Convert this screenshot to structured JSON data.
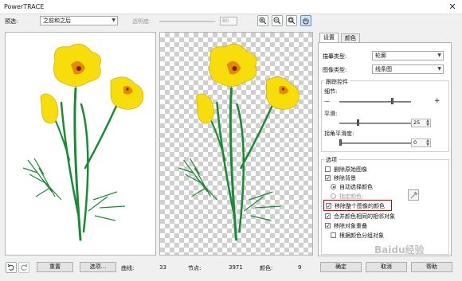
{
  "window": {
    "title": "PowerTRACE",
    "close_label": "✕"
  },
  "toolbar": {
    "preview_label": "预选:",
    "preview_value": "之前和之后",
    "transparency_label": "透明度:",
    "transparency_value": "80",
    "zoom_in_icon": "zoom-in-icon",
    "zoom_out_icon": "zoom-out-icon",
    "zoom_fit_icon": "zoom-fit-icon",
    "pan_icon": "hand-pan-icon"
  },
  "tabs": [
    {
      "label": "设置"
    },
    {
      "label": "颜色"
    }
  ],
  "settings": {
    "trace_type_label": "描摹类型:",
    "trace_type_value": "轮廓",
    "image_type_label": "图像类型:",
    "image_type_value": "线条图"
  },
  "trace_controls": {
    "title": "跟踪控件",
    "detail_label": "细节:",
    "minus": "—",
    "plus": "+",
    "detail_level": 0.75,
    "smoothing_label": "平滑:",
    "smoothing_value": "25",
    "smoothing_level": 0.25,
    "corner_label": "拐角平滑度:",
    "corner_value": "0",
    "corner_level": 0
  },
  "options": {
    "title": "选项",
    "delete_original_label": "删除原始图像",
    "delete_original_checked": false,
    "remove_background_label": "移除背景",
    "remove_background_checked": true,
    "auto_color_label": "自动选择颜色",
    "specify_color_label": "指定颜色:",
    "remove_whole_image_label": "移除整个图像的颜色",
    "remove_whole_image_checked": true,
    "merge_adjacent_label": "合并颜色相同的相邻对象",
    "merge_adjacent_checked": true,
    "remove_overlap_label": "移除对象重叠",
    "remove_overlap_checked": true,
    "group_by_color_label": "根据颜色分组对象",
    "group_by_color_checked": false,
    "highlight_color": "#d40000"
  },
  "status": {
    "reset_label": "重置",
    "options_label": "选项...",
    "curves_label": "曲线:",
    "curves_value": "33",
    "nodes_label": "节点:",
    "nodes_value": "3971",
    "colors_label": "颜色:",
    "colors_value": "9",
    "ok_label": "确定",
    "cancel_label": "取消",
    "help_label": "帮助",
    "undo_icon": "undo-icon",
    "redo_icon": "redo-icon"
  },
  "watermark": {
    "text": "Baidu经验"
  },
  "colors": {
    "accent": "#5b8fc9",
    "petal": "#f7dd0a",
    "stem": "#1a8a34",
    "highlight_box": "#d40000"
  }
}
